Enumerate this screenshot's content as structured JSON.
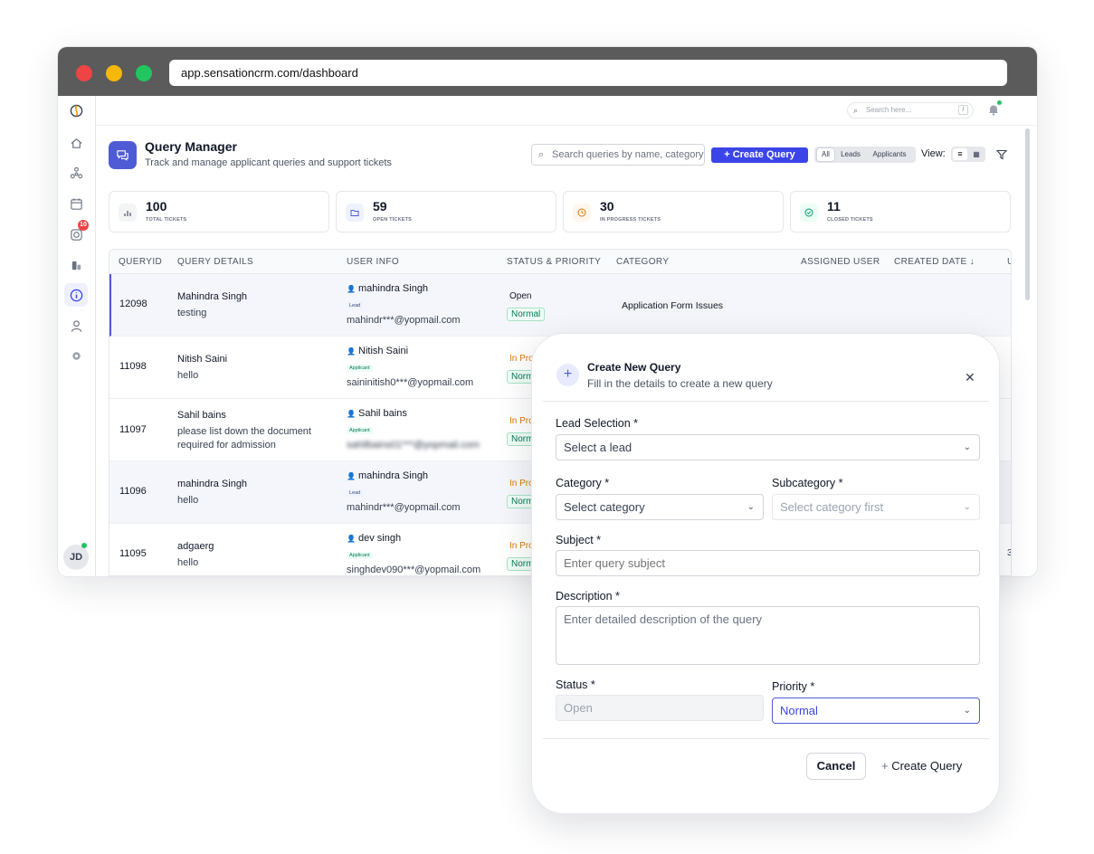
{
  "browser": {
    "url": "app.sensationcrm.com/dashboard"
  },
  "sidebar": {
    "badge": "10",
    "avatar": "JD"
  },
  "topbar": {
    "search_placeholder": "Search here...",
    "shortcut": "/"
  },
  "header": {
    "title": "Query Manager",
    "subtitle": "Track and manage applicant queries and support tickets",
    "search_placeholder": "Search queries by name, category",
    "create_label": "Create Query",
    "filters": [
      "All",
      "Leads",
      "Applicants"
    ],
    "view_label": "View:"
  },
  "stats": [
    {
      "value": "100",
      "label": "TOTAL TICKETS"
    },
    {
      "value": "59",
      "label": "OPEN TICKETS"
    },
    {
      "value": "30",
      "label": "IN PROGRESS TICKETS"
    },
    {
      "value": "11",
      "label": "CLOSED TICKETS"
    }
  ],
  "table": {
    "columns": [
      "QUERYID",
      "QUERY DETAILS",
      "USER INFO",
      "STATUS & PRIORITY",
      "CATEGORY",
      "ASSIGNED USER",
      "CREATED DATE ↓",
      "U"
    ],
    "rows": [
      {
        "id": "12098",
        "name": "Mahindra Singh",
        "detail": "testing",
        "user": "mahindra Singh",
        "type": "Lead",
        "email": "mahindr***@yopmail.com",
        "status": "Open",
        "priority": "Normal",
        "category": "Application Form Issues"
      },
      {
        "id": "11098",
        "name": "Nitish Saini",
        "detail": "hello",
        "user": "Nitish Saini",
        "type": "Applicant",
        "email": "saininitish0***@yopmail.com",
        "status": "In Pro",
        "priority": "Norm"
      },
      {
        "id": "11097",
        "name": "Sahil bains",
        "detail": "please list down the document",
        "detail2": "required for admission",
        "user": "Sahil bains",
        "type": "Applicant",
        "email": "sahilbains01***@yopmail.com",
        "status": "In Pro",
        "priority": "Norm"
      },
      {
        "id": "11096",
        "name": "mahindra Singh",
        "detail": "hello",
        "user": "mahindra Singh",
        "type": "Lead",
        "email": "mahindr***@yopmail.com",
        "status": "In Pro",
        "priority": "Norm"
      },
      {
        "id": "11095",
        "name": "adgaerg",
        "detail": "hello",
        "user": "dev singh",
        "type": "Applicant",
        "email": "singhdev090***@yopmail.com",
        "status": "In Pro",
        "priority": "Norm",
        "extra": "3"
      }
    ]
  },
  "modal": {
    "title": "Create New Query",
    "subtitle": "Fill in the details to create a new query",
    "lead_label": "Lead Selection *",
    "lead_placeholder": "Select a lead",
    "category_label": "Category *",
    "category_placeholder": "Select category",
    "subcategory_label": "Subcategory *",
    "subcategory_placeholder": "Select category first",
    "subject_label": "Subject *",
    "subject_placeholder": "Enter query subject",
    "description_label": "Description *",
    "description_placeholder": "Enter detailed description of the query",
    "status_label": "Status *",
    "status_value": "Open",
    "priority_label": "Priority *",
    "priority_value": "Normal",
    "cancel_label": "Cancel",
    "create_label": "Create Query"
  },
  "colors": {
    "accent": "#3b44e6",
    "green": "#047857",
    "orange": "#d97706",
    "red": "#ef4444"
  }
}
